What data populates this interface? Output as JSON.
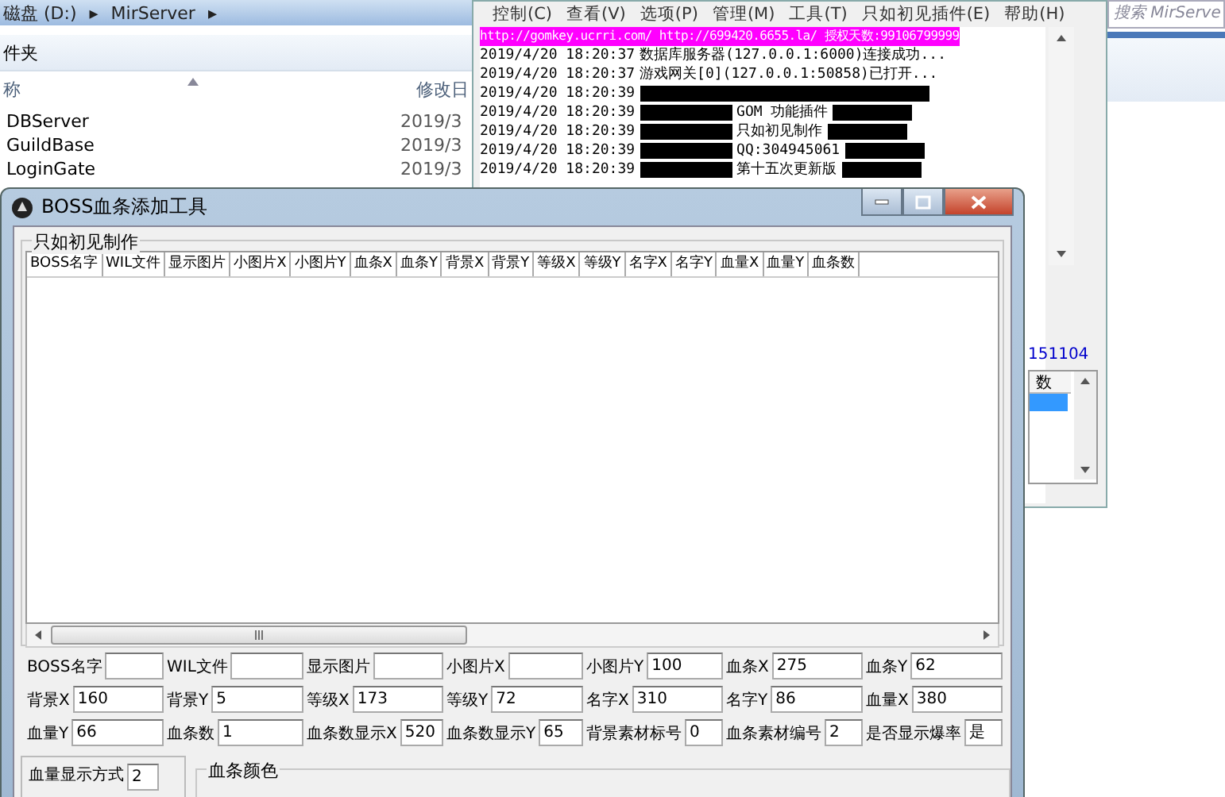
{
  "explorer": {
    "breadcrumb": [
      "磁盘 (D:)",
      "▸",
      "MirServer",
      "▸"
    ],
    "toolbar_label": "件夹",
    "columns": [
      "称",
      "修改日"
    ],
    "rows": [
      {
        "name": "DBServer",
        "date": "2019/3"
      },
      {
        "name": "GuildBase",
        "date": "2019/3"
      },
      {
        "name": "LoginGate",
        "date": "2019/3"
      }
    ]
  },
  "console": {
    "menu": [
      "控制(C)",
      "查看(V)",
      "选项(P)",
      "管理(M)",
      "工具(T)",
      "只如初见插件(E)",
      "帮助(H)"
    ],
    "log": [
      {
        "kind": "url",
        "text": "http://gomkey.ucrri.com/ http://699420.6655.la/ 授权天数:99106799999"
      },
      {
        "kind": "plain",
        "time": "2019/4/20 18:20:37",
        "text": "数据库服务器(127.0.0.1:6000)连接成功..."
      },
      {
        "kind": "plain",
        "time": "2019/4/20 18:20:37",
        "text": "游戏网关[0](127.0.0.1:50858)已打开..."
      },
      {
        "kind": "masked",
        "time": "2019/4/20 18:20:39"
      },
      {
        "kind": "masked",
        "time": "2019/4/20 18:20:39",
        "text": "GOM 功能插件"
      },
      {
        "kind": "masked",
        "time": "2019/4/20 18:20:39",
        "text": "只如初见制作"
      },
      {
        "kind": "masked",
        "time": "2019/4/20 18:20:39",
        "text": "QQ:304945061"
      },
      {
        "kind": "masked",
        "time": "2019/4/20 18:20:39",
        "text": "第十五次更新版"
      }
    ],
    "number_text": "151104",
    "list": {
      "header": "数",
      "rows": [
        {
          "selected": true
        }
      ]
    }
  },
  "search": {
    "placeholder": "搜索 MirServe"
  },
  "boss_window": {
    "title": "BOSS血条添加工具",
    "group_title": "只如初见制作",
    "columns": [
      "BOSS名字",
      "WIL文件",
      "显示图片",
      "小图片X",
      "小图片Y",
      "血条X",
      "血条Y",
      "背景X",
      "背景Y",
      "等级X",
      "等级Y",
      "名字X",
      "名字Y",
      "血量X",
      "血量Y",
      "血条数"
    ],
    "fields": [
      [
        {
          "label": "BOSS名字"
        },
        {
          "label": "WIL文件"
        },
        {
          "label": "显示图片"
        },
        {
          "label": "小图片X"
        },
        {
          "label": "小图片Y",
          "value": "100"
        },
        {
          "label": "血条X",
          "value": "275"
        },
        {
          "label": "血条Y",
          "value": "62"
        }
      ],
      [
        {
          "label": "背景X",
          "value": "160"
        },
        {
          "label": "背景Y",
          "value": "5"
        },
        {
          "label": "等级X",
          "value": "173"
        },
        {
          "label": "等级Y",
          "value": "72"
        },
        {
          "label": "名字X",
          "value": "310"
        },
        {
          "label": "名字Y",
          "value": "86"
        },
        {
          "label": "血量X",
          "value": "380"
        }
      ],
      [
        {
          "label": "血量Y",
          "value": "66"
        },
        {
          "label": "血条数",
          "value": "1"
        },
        {
          "label": "血条数显示X",
          "value": "520"
        },
        {
          "label": "血条数显示Y",
          "value": "65"
        },
        {
          "label": "背景素材标号",
          "value": "0"
        },
        {
          "label": "血条素材编号",
          "value": "2"
        },
        {
          "label": "是否显示爆率",
          "value": "是"
        }
      ]
    ],
    "display_mode": {
      "label": "血量显示方式",
      "value": "2"
    },
    "color_group_title": "血条颜色"
  }
}
